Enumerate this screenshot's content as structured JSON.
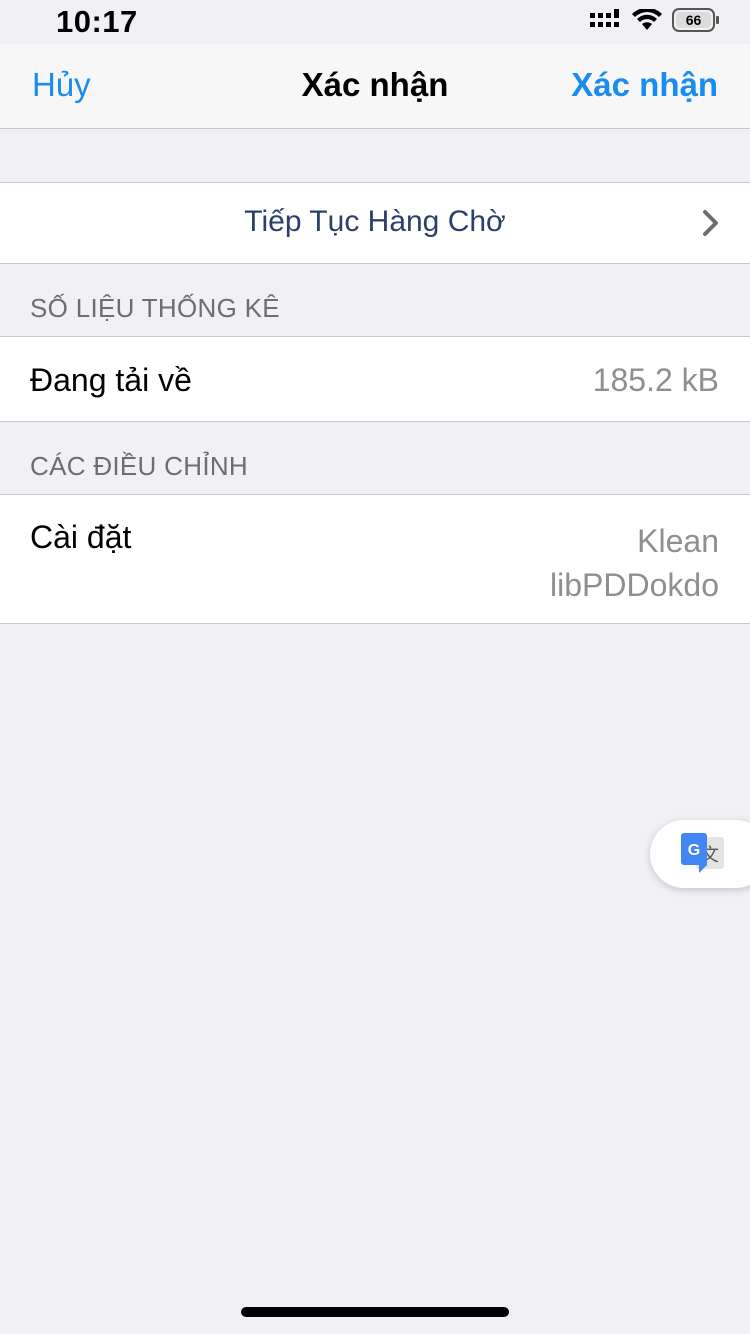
{
  "status_bar": {
    "time": "10:17",
    "battery_level": "66",
    "icons": [
      "signal-icon",
      "wifi-icon",
      "battery-icon"
    ]
  },
  "nav": {
    "cancel_label": "Hủy",
    "title": "Xác nhận",
    "confirm_label": "Xác nhận"
  },
  "queue": {
    "label": "Tiếp Tục Hàng Chờ",
    "icon": "chevron-right-icon"
  },
  "stats": {
    "header": "SỐ LIỆU THỐNG KÊ",
    "download_label": "Đang tải về",
    "download_value": "185.2 kB"
  },
  "adjustments": {
    "header": "CÁC ĐIỀU CHỈNH",
    "install_label": "Cài đặt",
    "install_values": [
      "Klean",
      "libPDDokdo"
    ]
  },
  "floating": {
    "icon": "google-translate-icon"
  },
  "colors": {
    "accent": "#1a8cf0",
    "background": "#f0f0f5",
    "secondary_text": "#8e8e93",
    "header_text": "#6d6d72"
  }
}
